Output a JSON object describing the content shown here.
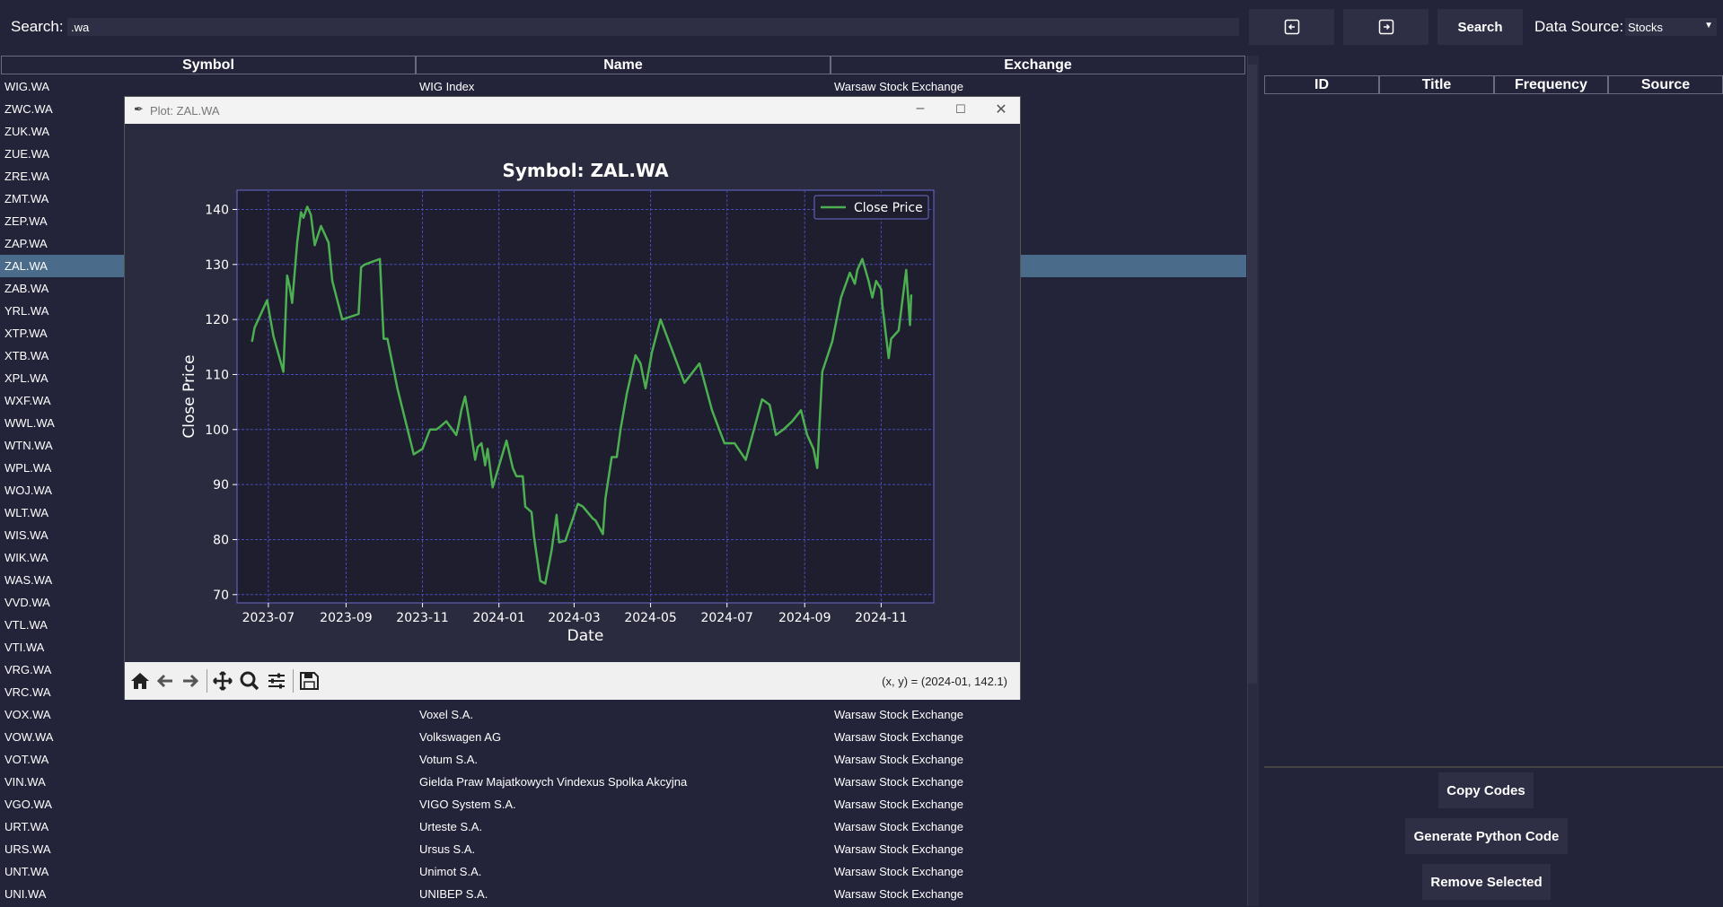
{
  "top": {
    "search_label": "Search:",
    "search_value": ".wa",
    "search_button": "Search",
    "datasource_label": "Data Source:",
    "datasource_value": "Stocks"
  },
  "table": {
    "headers": [
      "Symbol",
      "Name",
      "Exchange"
    ],
    "rows": [
      {
        "symbol": "WIG.WA",
        "name": "WIG Index",
        "exchange": "Warsaw Stock Exchange"
      },
      {
        "symbol": "ZWC.WA",
        "name": "",
        "exchange": ""
      },
      {
        "symbol": "ZUK.WA",
        "name": "",
        "exchange": ""
      },
      {
        "symbol": "ZUE.WA",
        "name": "",
        "exchange": ""
      },
      {
        "symbol": "ZRE.WA",
        "name": "",
        "exchange": ""
      },
      {
        "symbol": "ZMT.WA",
        "name": "",
        "exchange": ""
      },
      {
        "symbol": "ZEP.WA",
        "name": "",
        "exchange": ""
      },
      {
        "symbol": "ZAP.WA",
        "name": "",
        "exchange": ""
      },
      {
        "symbol": "ZAL.WA",
        "name": "",
        "exchange": "",
        "selected": true
      },
      {
        "symbol": "ZAB.WA",
        "name": "",
        "exchange": ""
      },
      {
        "symbol": "YRL.WA",
        "name": "",
        "exchange": ""
      },
      {
        "symbol": "XTP.WA",
        "name": "",
        "exchange": ""
      },
      {
        "symbol": "XTB.WA",
        "name": "",
        "exchange": ""
      },
      {
        "symbol": "XPL.WA",
        "name": "",
        "exchange": ""
      },
      {
        "symbol": "WXF.WA",
        "name": "",
        "exchange": ""
      },
      {
        "symbol": "WWL.WA",
        "name": "",
        "exchange": ""
      },
      {
        "symbol": "WTN.WA",
        "name": "",
        "exchange": ""
      },
      {
        "symbol": "WPL.WA",
        "name": "",
        "exchange": ""
      },
      {
        "symbol": "WOJ.WA",
        "name": "",
        "exchange": ""
      },
      {
        "symbol": "WLT.WA",
        "name": "",
        "exchange": ""
      },
      {
        "symbol": "WIS.WA",
        "name": "",
        "exchange": ""
      },
      {
        "symbol": "WIK.WA",
        "name": "",
        "exchange": ""
      },
      {
        "symbol": "WAS.WA",
        "name": "",
        "exchange": ""
      },
      {
        "symbol": "VVD.WA",
        "name": "",
        "exchange": ""
      },
      {
        "symbol": "VTL.WA",
        "name": "",
        "exchange": ""
      },
      {
        "symbol": "VTI.WA",
        "name": "",
        "exchange": ""
      },
      {
        "symbol": "VRG.WA",
        "name": "",
        "exchange": ""
      },
      {
        "symbol": "VRC.WA",
        "name": "",
        "exchange": ""
      },
      {
        "symbol": "VOX.WA",
        "name": "Voxel S.A.",
        "exchange": "Warsaw Stock Exchange"
      },
      {
        "symbol": "VOW.WA",
        "name": "Volkswagen AG",
        "exchange": "Warsaw Stock Exchange"
      },
      {
        "symbol": "VOT.WA",
        "name": "Votum S.A.",
        "exchange": "Warsaw Stock Exchange"
      },
      {
        "symbol": "VIN.WA",
        "name": "Gielda Praw Majatkowych Vindexus Spolka Akcyjna",
        "exchange": "Warsaw Stock Exchange"
      },
      {
        "symbol": "VGO.WA",
        "name": "VIGO System S.A.",
        "exchange": "Warsaw Stock Exchange"
      },
      {
        "symbol": "URT.WA",
        "name": "Urteste S.A.",
        "exchange": "Warsaw Stock Exchange"
      },
      {
        "symbol": "URS.WA",
        "name": "Ursus S.A.",
        "exchange": "Warsaw Stock Exchange"
      },
      {
        "symbol": "UNT.WA",
        "name": "Unimot S.A.",
        "exchange": "Warsaw Stock Exchange"
      },
      {
        "symbol": "UNI.WA",
        "name": "UNIBEP S.A.",
        "exchange": "Warsaw Stock Exchange"
      }
    ]
  },
  "right_table": {
    "headers": [
      "ID",
      "Title",
      "Frequency",
      "Source"
    ]
  },
  "right_buttons": {
    "copy": "Copy Codes",
    "generate": "Generate Python Code",
    "remove": "Remove Selected"
  },
  "plot_window": {
    "title": "Plot: ZAL.WA",
    "coords": "(x, y) = (2024-01, 142.1)"
  },
  "colors": {
    "background": "#23233a",
    "plot_bg": "#1e1e2e",
    "grid": "#4a4ab8",
    "line": "#4caf50",
    "selected_row": "#4a6c8a"
  },
  "chart_data": {
    "type": "line",
    "title": "Symbol: ZAL.WA",
    "xlabel": "Date",
    "ylabel": "Close Price",
    "legend": "top-right",
    "grid": true,
    "ylim": [
      68.5,
      143.5
    ],
    "yticks": [
      70,
      80,
      90,
      100,
      110,
      120,
      130,
      140
    ],
    "xlim": [
      "2023-06-06",
      "2024-12-13"
    ],
    "xticks": [
      "2023-07",
      "2023-09",
      "2023-11",
      "2024-01",
      "2024-03",
      "2024-05",
      "2024-07",
      "2024-09",
      "2024-11"
    ],
    "series": [
      {
        "name": "Close Price",
        "x": [
          "2023-06-18",
          "2023-06-20",
          "2023-06-30",
          "2023-07-05",
          "2023-07-13",
          "2023-07-16",
          "2023-07-18",
          "2023-07-20",
          "2023-07-24",
          "2023-07-27",
          "2023-07-29",
          "2023-08-01",
          "2023-08-02",
          "2023-08-04",
          "2023-08-07",
          "2023-08-12",
          "2023-08-18",
          "2023-08-21",
          "2023-08-29",
          "2023-09-11",
          "2023-09-13",
          "2023-09-16",
          "2023-09-28",
          "2023-10-01",
          "2023-10-04",
          "2023-10-12",
          "2023-10-25",
          "2023-11-01",
          "2023-11-07",
          "2023-11-12",
          "2023-11-15",
          "2023-11-20",
          "2023-11-28",
          "2023-11-30",
          "2023-12-02",
          "2023-12-05",
          "2023-12-08",
          "2023-12-10",
          "2023-12-13",
          "2023-12-15",
          "2023-12-18",
          "2023-12-20",
          "2023-12-21",
          "2023-12-23",
          "2023-12-27",
          "2024-01-07",
          "2024-01-12",
          "2024-01-15",
          "2024-01-20",
          "2024-01-22",
          "2024-01-27",
          "2024-01-29",
          "2024-02-03",
          "2024-02-07",
          "2024-02-12",
          "2024-02-16",
          "2024-02-18",
          "2024-02-23",
          "2024-03-04",
          "2024-03-08",
          "2024-03-16",
          "2024-03-18",
          "2024-03-24",
          "2024-03-26",
          "2024-03-31",
          "2024-04-04",
          "2024-04-07",
          "2024-04-12",
          "2024-04-19",
          "2024-04-23",
          "2024-04-27",
          "2024-05-02",
          "2024-05-09",
          "2024-05-28",
          "2024-06-09",
          "2024-06-19",
          "2024-06-24",
          "2024-06-29",
          "2024-07-03",
          "2024-07-07",
          "2024-07-16",
          "2024-07-29",
          "2024-08-04",
          "2024-08-09",
          "2024-08-15",
          "2024-08-22",
          "2024-08-29",
          "2024-09-03",
          "2024-09-08",
          "2024-09-11",
          "2024-09-15",
          "2024-09-23",
          "2024-09-30",
          "2024-10-07",
          "2024-10-11",
          "2024-10-13",
          "2024-10-17",
          "2024-10-22",
          "2024-10-25",
          "2024-10-28",
          "2024-11-01",
          "2024-11-02",
          "2024-11-07",
          "2024-11-09",
          "2024-11-15",
          "2024-11-21",
          "2024-11-24",
          "2024-11-25"
        ],
        "y": [
          116,
          118.5,
          123.5,
          117,
          110.5,
          128,
          126,
          123,
          134,
          139.5,
          138.5,
          140.5,
          140,
          139,
          133.5,
          137,
          134,
          127,
          120,
          121,
          129.5,
          130,
          131,
          116.5,
          116.5,
          107.5,
          95.5,
          96.5,
          100,
          100,
          100.5,
          101.5,
          99,
          101,
          103.5,
          106,
          102,
          99,
          94.5,
          96.8,
          97.5,
          95,
          93.5,
          96.5,
          89.5,
          98,
          93,
          91.5,
          91.5,
          86,
          85,
          80.5,
          72.5,
          72,
          78,
          84.5,
          79.5,
          79.8,
          86.5,
          86,
          83.8,
          83.5,
          81,
          87.5,
          95,
          95,
          100,
          106.5,
          113.5,
          112,
          107.5,
          114,
          120,
          108.5,
          112,
          103.5,
          100.5,
          97.5,
          97.5,
          97.5,
          94.5,
          105.5,
          104.5,
          99,
          100,
          101.5,
          103.5,
          99,
          96.5,
          93,
          110.5,
          116,
          124,
          128.5,
          126.5,
          129,
          131,
          127,
          124,
          127,
          125.5,
          122.5,
          113,
          116.5,
          118,
          129,
          119,
          124.5
        ]
      }
    ]
  }
}
